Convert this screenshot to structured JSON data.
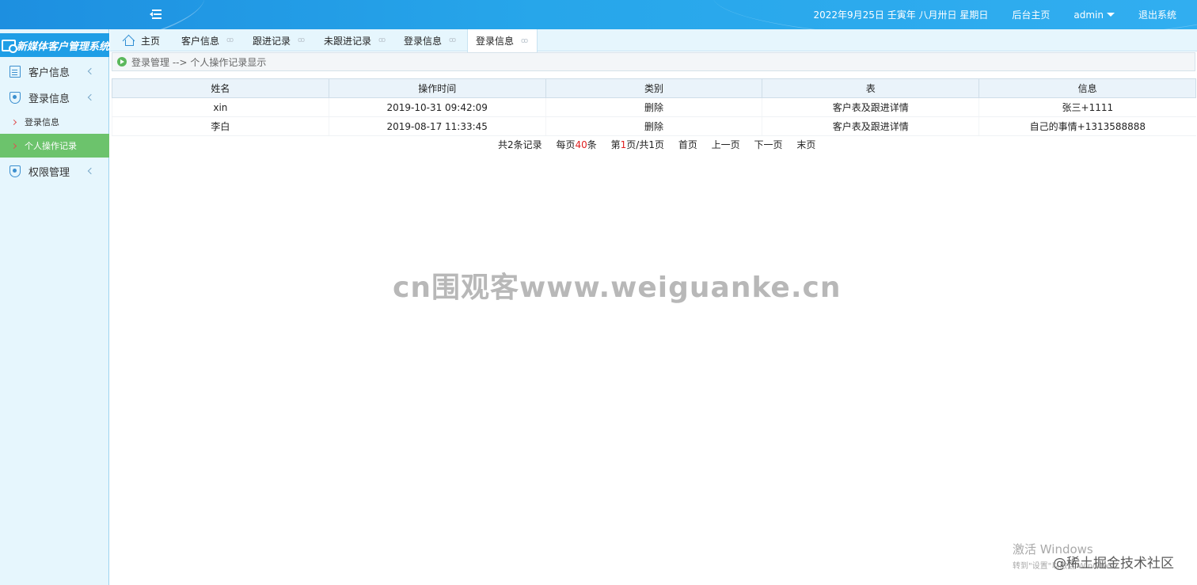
{
  "header": {
    "date": "2022年9月25日 壬寅年 八月卅日 星期日",
    "home_link": "后台主页",
    "user": "admin",
    "logout": "退出系统"
  },
  "sidebar": {
    "logo": "新媒体客户管理系统",
    "items": [
      {
        "label": "客户信息",
        "icon": "document-icon"
      },
      {
        "label": "登录信息",
        "icon": "shield-icon"
      },
      {
        "label": "权限管理",
        "icon": "shield-icon"
      }
    ],
    "subitems": [
      {
        "label": "登录信息"
      },
      {
        "label": "个人操作记录",
        "active": true
      }
    ]
  },
  "tabs": [
    {
      "label": "主页"
    },
    {
      "label": "客户信息",
      "close": "ꝏ"
    },
    {
      "label": "跟进记录",
      "close": "ꝏ"
    },
    {
      "label": "未跟进记录",
      "close": "ꝏ"
    },
    {
      "label": "登录信息",
      "close": "ꝏ"
    },
    {
      "label": "登录信息",
      "close": "ꝏ",
      "active": true
    }
  ],
  "breadcrumb": "登录管理 --> 个人操作记录显示",
  "table": {
    "columns": [
      "姓名",
      "操作时间",
      "类别",
      "表",
      "信息"
    ],
    "rows": [
      [
        "xin",
        "2019-10-31 09:42:09",
        "删除",
        "客户表及跟进详情",
        "张三+1111"
      ],
      [
        "李白",
        "2019-08-17 11:33:45",
        "删除",
        "客户表及跟进详情",
        "自己的事情+1313588888"
      ]
    ]
  },
  "pager": {
    "total_prefix": "共",
    "total": "2",
    "total_suffix": "条记录",
    "per_page_prefix": "每页",
    "per_page": "40",
    "per_page_suffix": "条",
    "page_prefix": "第",
    "page": "1",
    "page_suffix": "页/共1页",
    "first": "首页",
    "prev": "上一页",
    "next": "下一页",
    "last": "末页"
  },
  "overlay": {
    "watermark": "cn围观客www.weiguanke.cn",
    "win_title": "激活 Windows",
    "win_sub": "转到\"设置\"以激活 Windows。",
    "juejin": "@稀土掘金技术社区"
  },
  "colors": {
    "header_blue": "#27a6ea",
    "active_green": "#6cc36c",
    "accent_red": "#e02020"
  }
}
